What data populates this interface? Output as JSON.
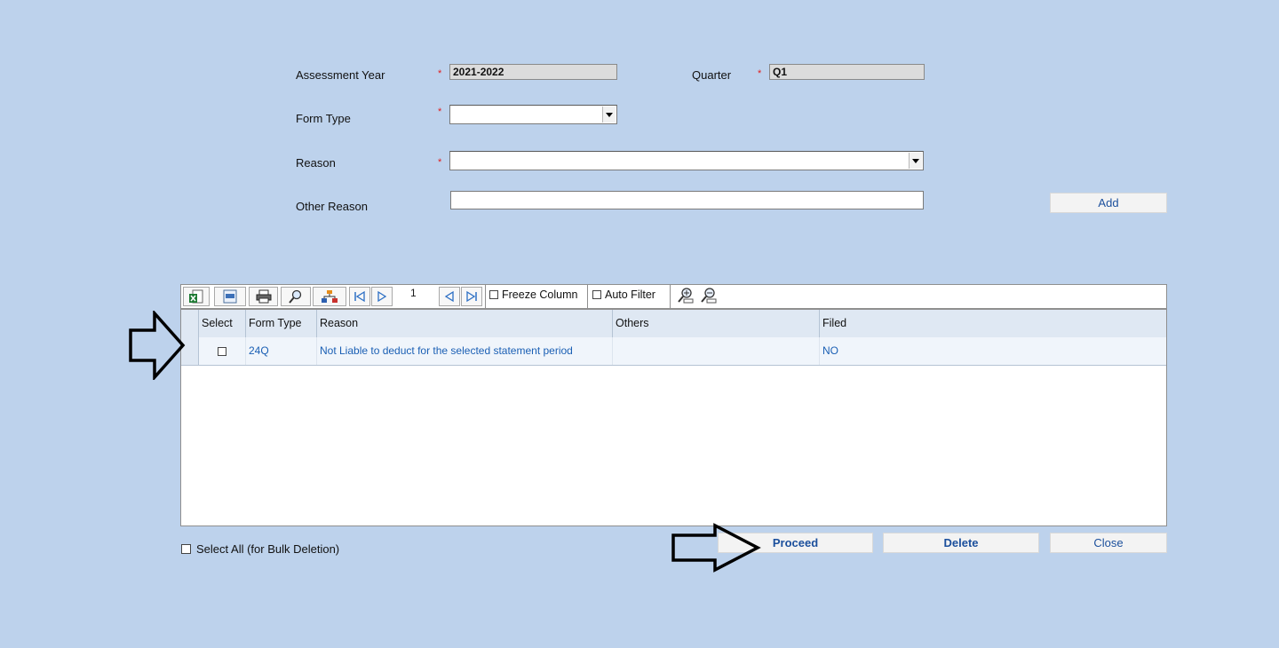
{
  "form": {
    "assessment_year_label": "Assessment Year",
    "assessment_year_value": "2021-2022",
    "quarter_label": "Quarter",
    "quarter_value": "Q1",
    "form_type_label": "Form Type",
    "form_type_value": "",
    "reason_label": "Reason",
    "reason_value": "",
    "other_reason_label": "Other Reason",
    "other_reason_value": "",
    "required_mark": "*",
    "add_label": "Add"
  },
  "toolbar": {
    "page_number": "1",
    "freeze_column_label": "Freeze Column",
    "auto_filter_label": "Auto Filter",
    "icons": [
      "excel-export-icon",
      "csv-export-icon",
      "print-icon",
      "search-icon",
      "hierarchy-icon",
      "first-page-icon",
      "next-page-icon",
      "previous-page-icon",
      "last-page-icon",
      "zoom-in-icon",
      "zoom-out-icon"
    ]
  },
  "grid": {
    "columns": [
      "Select",
      "Form Type",
      "Reason",
      "Others",
      "Filed"
    ],
    "rows": [
      {
        "select": false,
        "form_type": "24Q",
        "reason": "Not Liable to deduct for the selected statement period",
        "others": "",
        "filed": "NO"
      }
    ]
  },
  "footer": {
    "select_all_label": "Select All (for Bulk Deletion)",
    "proceed_label": "Proceed",
    "delete_label": "Delete",
    "close_label": "Close"
  },
  "colors": {
    "background": "#bdd2ec",
    "link_blue": "#1a5fb4",
    "required_red": "#e02020"
  }
}
